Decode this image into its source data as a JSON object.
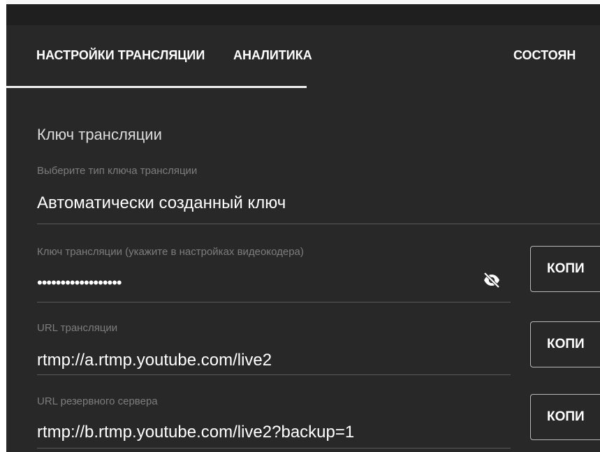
{
  "tabs": [
    {
      "label": "НАСТРОЙКИ ТРАНСЛЯЦИИ",
      "active": true
    },
    {
      "label": "АНАЛИТИКА",
      "active": false
    },
    {
      "label": "СОСТОЯН",
      "active": false
    }
  ],
  "stream_key_section": {
    "title": "Ключ трансляции",
    "key_type": {
      "label": "Выберите тип ключа трансляции",
      "value": "Автоматически созданный ключ"
    },
    "stream_key": {
      "label": "Ключ трансляции (укажите в настройках видеокодера)",
      "value": "••••••••••••••••••",
      "visibility_icon": "eye-off-icon",
      "copy_label": "КОПИ"
    },
    "stream_url": {
      "label": "URL трансляции",
      "value": "rtmp://a.rtmp.youtube.com/live2",
      "copy_label": "КОПИ"
    },
    "backup_url": {
      "label": "URL резервного сервера",
      "value": "rtmp://b.rtmp.youtube.com/live2?backup=1",
      "copy_label": "КОПИ"
    }
  },
  "colors": {
    "panel_background": "#282828",
    "top_bar": "#1f1f1f",
    "text_primary": "#ffffff",
    "text_secondary": "#7d7d7d",
    "divider": "#5a5a5a"
  }
}
